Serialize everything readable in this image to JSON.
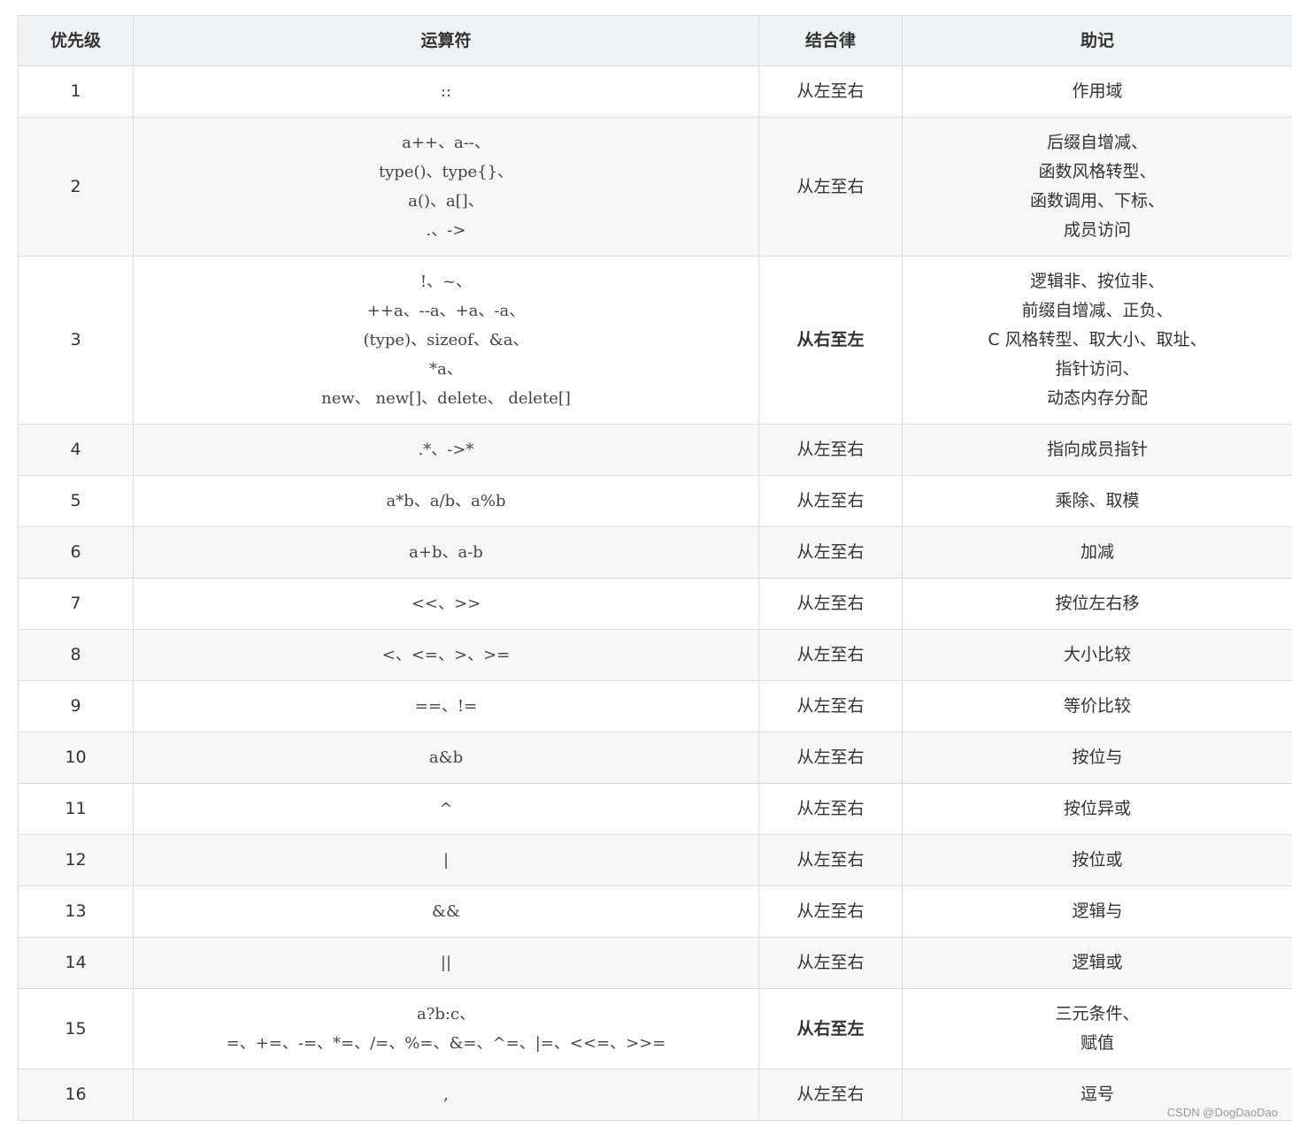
{
  "headers": [
    "优先级",
    "运算符",
    "结合律",
    "助记"
  ],
  "rows": [
    {
      "level": "1",
      "operators": [
        "::"
      ],
      "assoc": "从左至右",
      "rtl": false,
      "mnemonic": [
        "作用域"
      ],
      "height": 58
    },
    {
      "level": "2",
      "operators": [
        "a++、a--、",
        "type()、type{}、",
        "a()、a[]、",
        ".、->"
      ],
      "assoc": "从左至右",
      "rtl": false,
      "mnemonic": [
        "后缀自增减、",
        "函数风格转型、",
        "函数调用、下标、",
        "成员访问"
      ],
      "height": 157
    },
    {
      "level": "3",
      "operators": [
        "!、~、",
        "++a、--a、+a、-a、",
        "(type)、sizeof、&a、",
        "*a、",
        "new、 new[]、delete、 delete[]"
      ],
      "assoc": "从右至左",
      "rtl": true,
      "mnemonic": [
        "逻辑非、按位非、",
        "前缀自增减、正负、",
        "C 风格转型、取大小、取址、",
        "指针访问、",
        "动态内存分配"
      ],
      "height": 190
    },
    {
      "level": "4",
      "operators": [
        ".*、->*"
      ],
      "assoc": "从左至右",
      "rtl": false,
      "mnemonic": [
        "指向成员指针"
      ],
      "height": 58
    },
    {
      "level": "5",
      "operators": [
        "a*b、a/b、a%b"
      ],
      "assoc": "从左至右",
      "rtl": false,
      "mnemonic": [
        "乘除、取模"
      ],
      "height": 58
    },
    {
      "level": "6",
      "operators": [
        "a+b、a-b"
      ],
      "assoc": "从左至右",
      "rtl": false,
      "mnemonic": [
        "加减"
      ],
      "height": 58
    },
    {
      "level": "7",
      "operators": [
        "<<、>>"
      ],
      "assoc": "从左至右",
      "rtl": false,
      "mnemonic": [
        "按位左右移"
      ],
      "height": 58
    },
    {
      "level": "8",
      "operators": [
        "<、<=、>、>="
      ],
      "assoc": "从左至右",
      "rtl": false,
      "mnemonic": [
        "大小比较"
      ],
      "height": 58
    },
    {
      "level": "9",
      "operators": [
        "==、!="
      ],
      "assoc": "从左至右",
      "rtl": false,
      "mnemonic": [
        "等价比较"
      ],
      "height": 58
    },
    {
      "level": "10",
      "operators": [
        "a&b"
      ],
      "assoc": "从左至右",
      "rtl": false,
      "mnemonic": [
        "按位与"
      ],
      "height": 58
    },
    {
      "level": "11",
      "operators": [
        "^"
      ],
      "assoc": "从左至右",
      "rtl": false,
      "mnemonic": [
        "按位异或"
      ],
      "height": 58
    },
    {
      "level": "12",
      "operators": [
        "|"
      ],
      "assoc": "从左至右",
      "rtl": false,
      "mnemonic": [
        "按位或"
      ],
      "height": 58
    },
    {
      "level": "13",
      "operators": [
        "&&"
      ],
      "assoc": "从左至右",
      "rtl": false,
      "mnemonic": [
        "逻辑与"
      ],
      "height": 58
    },
    {
      "level": "14",
      "operators": [
        "||"
      ],
      "assoc": "从左至右",
      "rtl": false,
      "mnemonic": [
        "逻辑或"
      ],
      "height": 58
    },
    {
      "level": "15",
      "operators": [
        "a?b:c、",
        "=、+=、-=、*=、/=、%=、&=、^=、|=、<<=、>>="
      ],
      "assoc": "从右至左",
      "rtl": true,
      "mnemonic": [
        "三元条件、",
        "赋值"
      ],
      "height": 91
    },
    {
      "level": "16",
      "operators": [
        ","
      ],
      "assoc": "从左至右",
      "rtl": false,
      "mnemonic": [
        "逗号"
      ],
      "height": 58
    }
  ],
  "watermark": "CSDN @DogDaoDao"
}
